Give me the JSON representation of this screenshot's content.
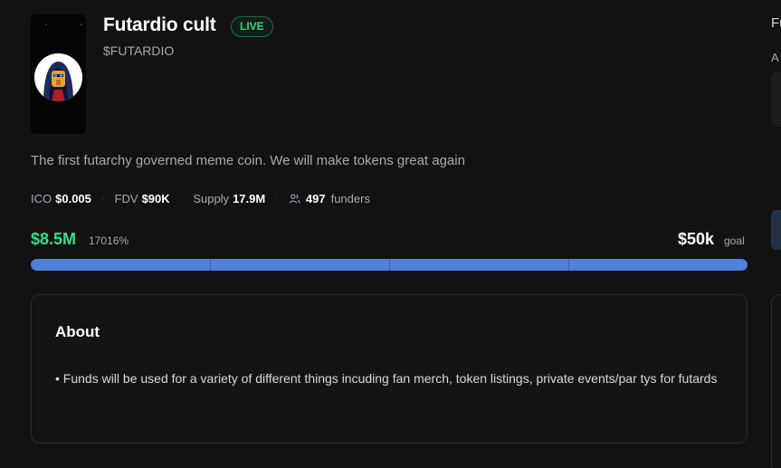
{
  "project": {
    "name": "Futardio cult",
    "status": "LIVE",
    "ticker": "$FUTARDIO",
    "description": "The first futarchy governed meme coin. We will make tokens great again"
  },
  "stats": [
    {
      "label": "ICO",
      "value": "$0.005"
    },
    {
      "label": "FDV",
      "value": "$90K"
    },
    {
      "label": "Supply",
      "value": "17.9M"
    }
  ],
  "funders": {
    "count": "497",
    "label": "funders",
    "icon": "users-icon"
  },
  "funding": {
    "raised": "$8.5M",
    "percent": "17016%",
    "goal_amount": "$50k",
    "goal_label": "goal",
    "progress_fraction": 1.0
  },
  "about": {
    "title": "About",
    "text": "• Funds will be used for a variety of different things incuding fan merch, token listings, private events/par tys for futards"
  },
  "sidebar": {
    "heading": "Fu",
    "label": "A"
  },
  "colors": {
    "background": "#121212",
    "accent_green": "#33e08a",
    "progress_blue": "#4f81dd",
    "muted_text": "#a7a9b5"
  }
}
